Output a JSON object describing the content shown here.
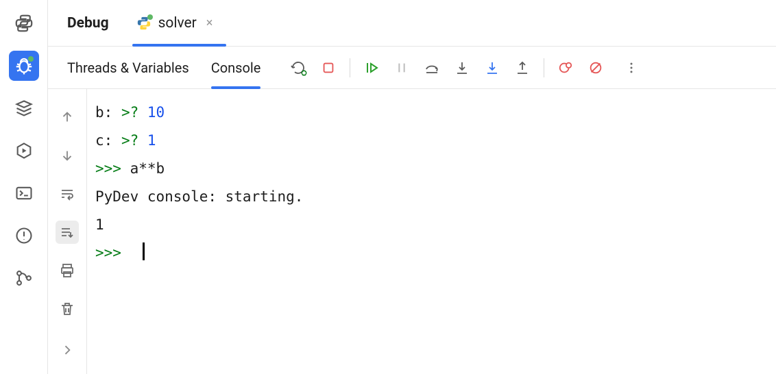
{
  "rail": {
    "items": [
      "python",
      "debug",
      "stack",
      "run",
      "terminal",
      "problems",
      "vcs"
    ]
  },
  "tabs": {
    "main_label": "Debug",
    "file_label": "solver"
  },
  "subtabs": {
    "threads": "Threads & Variables",
    "console": "Console"
  },
  "console": {
    "line0_var": "b: ",
    "line0_q": ">? ",
    "line0_val": "10",
    "line1_var": "c: ",
    "line1_q": ">? ",
    "line1_val": "1",
    "line2_prompt": ">>> ",
    "line2_expr": "a**b",
    "line3": "PyDev console: starting.",
    "blank": "",
    "line4": "1",
    "line5_prompt": ">>>  "
  }
}
